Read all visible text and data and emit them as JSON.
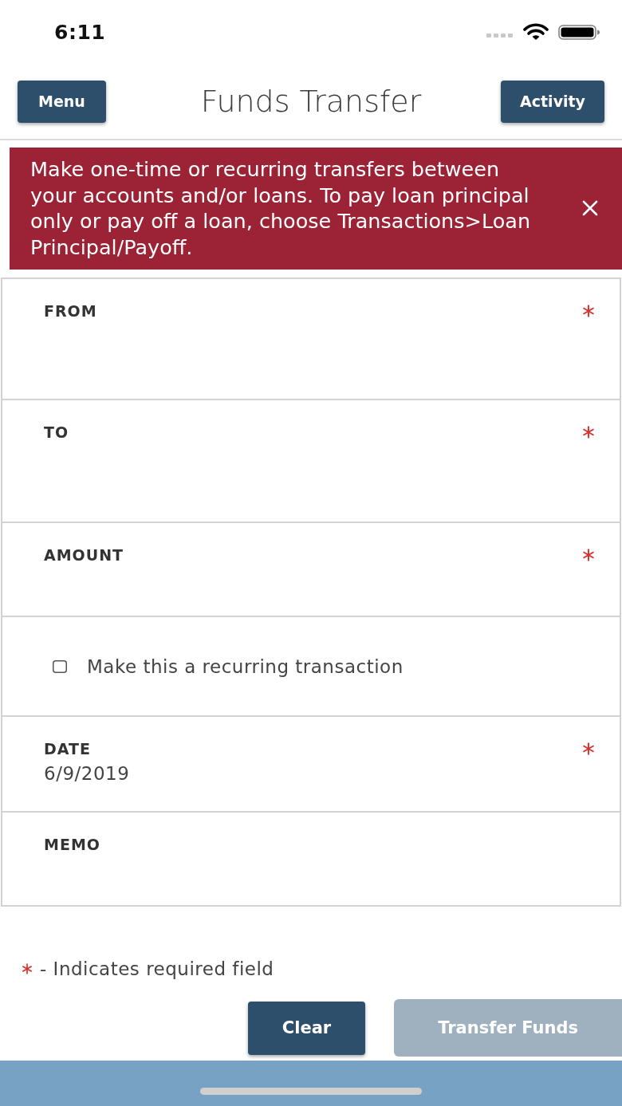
{
  "status_bar": {
    "time": "6:11"
  },
  "header": {
    "title": "Funds Transfer",
    "left_button": {
      "label": "Menu"
    },
    "right_button": {
      "label": "Activity"
    }
  },
  "banner": {
    "message": "Make one-time or recurring transfers between your accounts and/or loans. To pay loan principal only or pay off a loan, choose Transactions>Loan Principal/Payoff.",
    "dismissible": true
  },
  "form": {
    "fields": [
      {
        "kind": "select",
        "label": "FROM",
        "required": true
      },
      {
        "kind": "select",
        "label": "TO",
        "required": true
      },
      {
        "kind": "text",
        "label": "AMOUNT",
        "required": true
      },
      {
        "kind": "checkbox",
        "label": "Make this a recurring transaction",
        "checked": false
      },
      {
        "kind": "date",
        "label": "DATE",
        "required": true,
        "value": "6/9/2019"
      },
      {
        "kind": "text",
        "label": "MEMO",
        "required": false
      }
    ]
  },
  "required_note": "- Indicates required field",
  "actions": [
    {
      "label": "Clear",
      "disabled": false
    },
    {
      "label": "Transfer Funds",
      "disabled": true
    }
  ]
}
